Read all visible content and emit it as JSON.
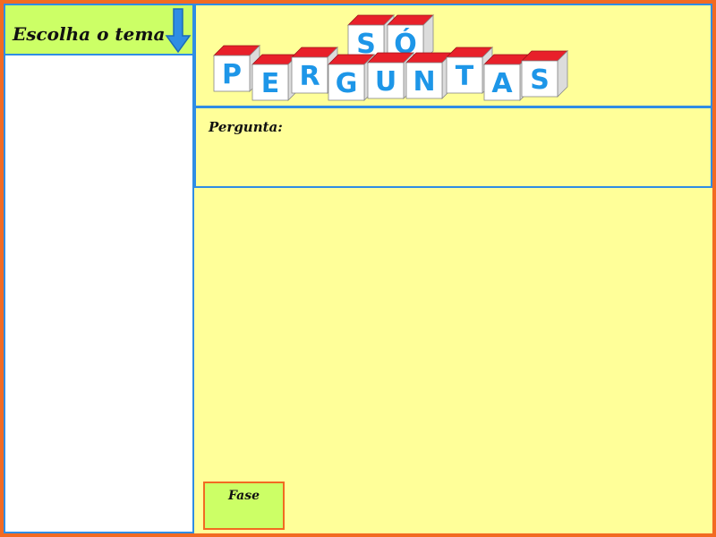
{
  "sidebar": {
    "header_label": "Escolha o tema",
    "arrow_icon": "arrow-down-icon",
    "items": []
  },
  "banner": {
    "logo_top_word": [
      "S",
      "Ó"
    ],
    "logo_bottom_word": [
      "P",
      "E",
      "R",
      "G",
      "U",
      "N",
      "T",
      "A",
      "S"
    ]
  },
  "question": {
    "label": "Pergunta:"
  },
  "phase_button": {
    "label": "Fase"
  },
  "colors": {
    "frame_border": "#f26a22",
    "panel_border": "#2f8de4",
    "background": "#ffff99",
    "header_green": "#ccff66",
    "block_red": "#e8202a",
    "block_letter": "#1d96e8"
  }
}
